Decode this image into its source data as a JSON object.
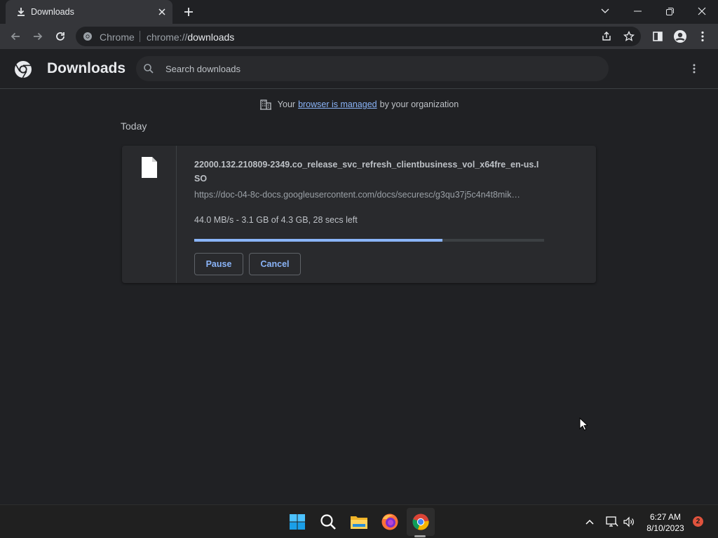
{
  "browser": {
    "tab_title": "Downloads",
    "omnibox_label": "Chrome",
    "url_scheme": "chrome://",
    "url_host": "downloads"
  },
  "page": {
    "title": "Downloads",
    "search_placeholder": "Search downloads"
  },
  "managed_banner": {
    "prefix": "Your",
    "link": "browser is managed",
    "suffix": "by your organization"
  },
  "section_date": "Today",
  "download": {
    "filename": "22000.132.210809-2349.co_release_svc_refresh_clientbusiness_vol_x64fre_en-us.ISO",
    "url": "https://doc-04-8c-docs.googleusercontent.com/docs/securesc/g3qu37j5c4n4t8mik…",
    "status": "44.0 MB/s - 3.1 GB of 4.3 GB, 28 secs left",
    "progress_percent": 71,
    "pause_label": "Pause",
    "cancel_label": "Cancel"
  },
  "taskbar": {
    "time": "6:27 AM",
    "date": "8/10/2023",
    "notification_count": "2"
  },
  "colors": {
    "accent": "#8ab4f8",
    "background": "#202124",
    "card": "#292a2d"
  }
}
